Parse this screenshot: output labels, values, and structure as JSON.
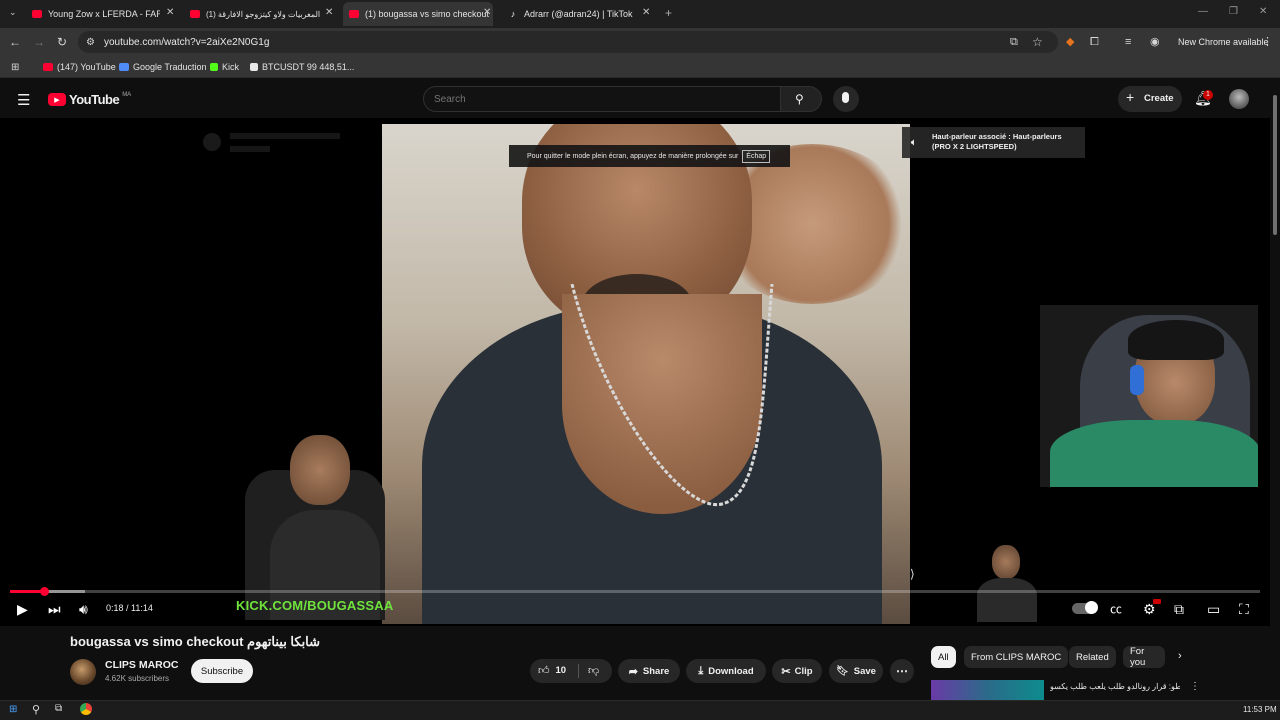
{
  "browser": {
    "tabs": [
      {
        "label": "Young Zow x LFERDA - FARIHA"
      },
      {
        "label": "(1) المغربيات ولاو كيتزوجو الافارقة"
      },
      {
        "label": "(1) bougassa vs simo checkout"
      },
      {
        "label": "Adrarr (@adran24) | TikTok"
      }
    ],
    "url": "youtube.com/watch?v=2aiXe2N0G1g",
    "new_chrome": "New Chrome available",
    "bookmarks": [
      {
        "label": "(147) YouTube",
        "color": "#ff0033"
      },
      {
        "label": "Google Traduction",
        "color": "#4f8cf7"
      },
      {
        "label": "Kick",
        "color": "#53fc18"
      },
      {
        "label": "BTCUSDT 99 448,51...",
        "color": "#e8e8e8"
      }
    ]
  },
  "header": {
    "logo_text": "YouTube",
    "country": "MA",
    "search_placeholder": "Search",
    "create_label": "Create",
    "notification_count": "1"
  },
  "player": {
    "fullscreen_hint": "Pour quitter le mode plein écran, appuyez de manière prolongée sur",
    "fullscreen_key": "Échap",
    "speaker_toast": "Haut-parleur associé : Haut-parleurs (PRO X 2 LIGHTSPEED)",
    "time": "0:18 / 11:14",
    "progress": 0.027,
    "buffered": 0.06,
    "overlay_text": "KICK.COM/BOUGASSAA",
    "accent": "#ff0033"
  },
  "video": {
    "title": "bougassa vs simo checkout شابكا بيناتهوم",
    "channel": "CLIPS MAROC",
    "subscribers": "4.62K subscribers",
    "subscribe_label": "Subscribe",
    "like_count": "10",
    "share_label": "Share",
    "download_label": "Download",
    "clip_label": "Clip",
    "save_label": "Save"
  },
  "filters": [
    {
      "label": "All",
      "active": true
    },
    {
      "label": "From CLIPS MAROC",
      "active": false
    },
    {
      "label": "Related",
      "active": false
    },
    {
      "label": "For you",
      "active": false
    }
  ],
  "related_preview": "طوطو: قرار رونالدو طلب يلعب طلب يكسو...",
  "taskbar": {
    "clock": "11:53 PM"
  }
}
